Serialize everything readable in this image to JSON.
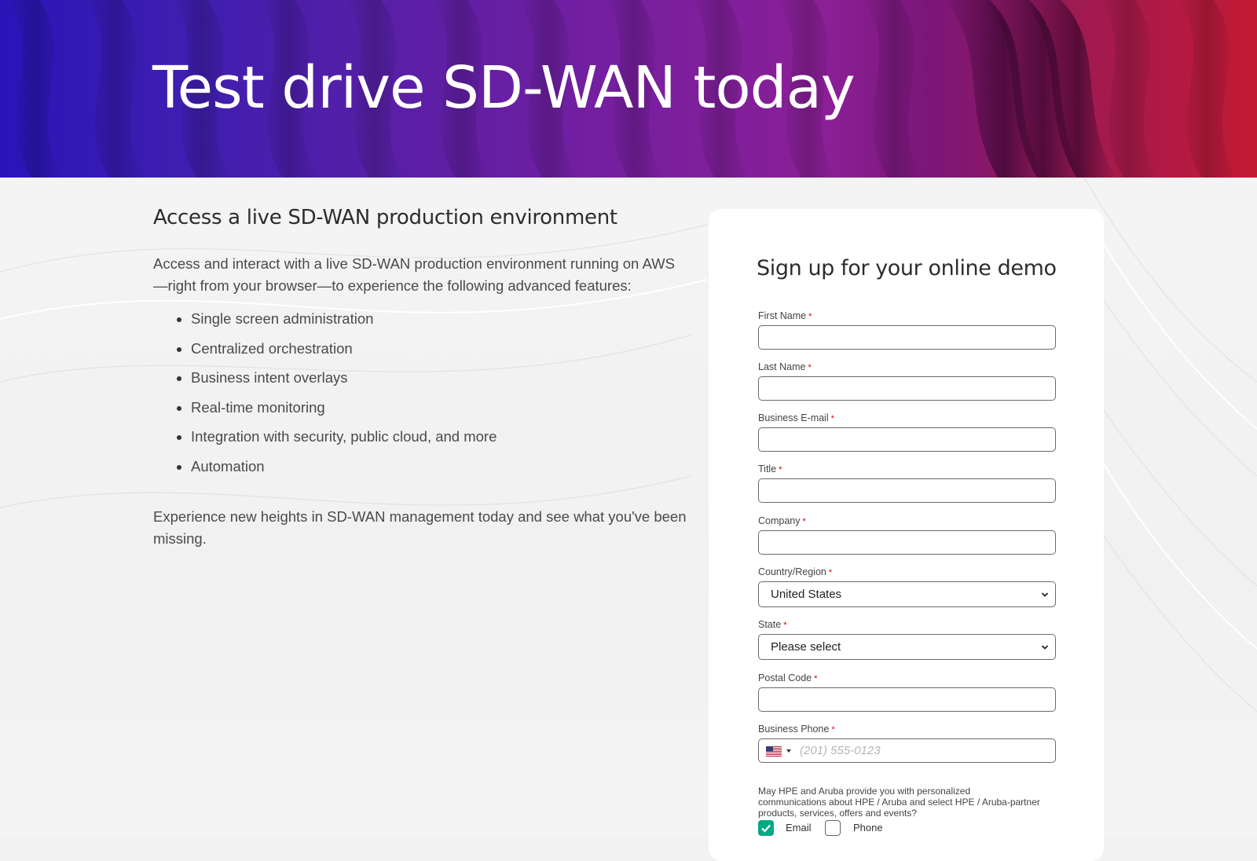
{
  "hero": {
    "title": "Test drive SD-WAN today"
  },
  "intro": {
    "heading": "Access a live SD-WAN production environment",
    "paragraph": "Access and interact with a live SD-WAN production environment running on AWS—right from your browser—to experience the following advanced features:",
    "features": [
      "Single screen administration",
      "Centralized orchestration",
      "Business intent overlays",
      "Real-time monitoring",
      "Integration with security, public cloud, and more",
      "Automation"
    ],
    "closing": "Experience new heights in SD-WAN management today and see what you've been missing."
  },
  "form": {
    "title": "Sign up for your online demo",
    "required_marker": "*",
    "fields": {
      "first_name": {
        "label": "First Name",
        "value": ""
      },
      "last_name": {
        "label": "Last Name",
        "value": ""
      },
      "email": {
        "label": "Business E-mail",
        "value": ""
      },
      "title": {
        "label": "Title",
        "value": ""
      },
      "company": {
        "label": "Company",
        "value": ""
      },
      "country": {
        "label": "Country/Region",
        "value": "United States"
      },
      "state": {
        "label": "State",
        "value": "Please select"
      },
      "postal": {
        "label": "Postal Code",
        "value": ""
      },
      "phone": {
        "label": "Business Phone",
        "placeholder": "(201) 555-0123",
        "flag": "us-flag-icon"
      }
    },
    "consent_text": "May HPE and Aruba provide you with personalized communications about HPE / Aruba and select HPE / Aruba-partner products, services, offers and events?",
    "consent_options": {
      "email": {
        "label": "Email",
        "checked": true
      },
      "phone": {
        "label": "Phone",
        "checked": false
      }
    }
  },
  "colors": {
    "hero_start": "#2a14b8",
    "hero_mid": "#7a1f9e",
    "hero_end": "#c21a34",
    "required": "#d40000",
    "check_accent": "#01a982"
  }
}
